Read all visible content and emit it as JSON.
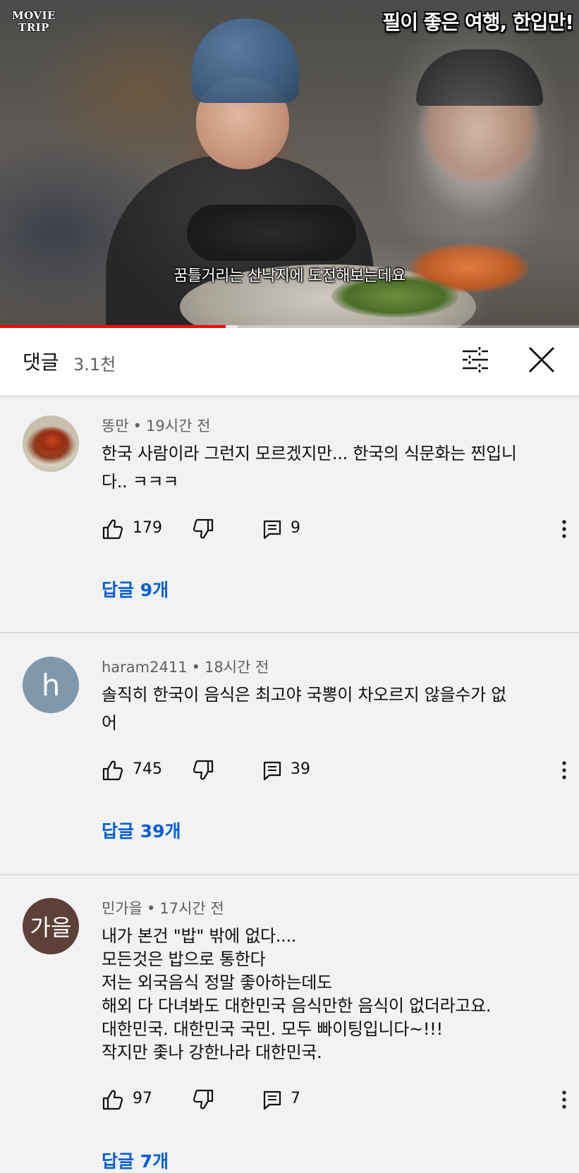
{
  "video": {
    "logo_line1": "MOVIE",
    "logo_line2": "TRIP",
    "title_overlay": "필이 좋은 여행, 한입만!",
    "subtitle": "꿈틀거리는 산낙지에 도전해보는데요",
    "progress_fraction": 0.39,
    "buffer_fraction": 0.02
  },
  "comments_header": {
    "title": "댓글",
    "count": "3.1천",
    "filter_icon": "sliders-icon",
    "close_icon": "close-icon"
  },
  "comments": [
    {
      "author": "똥만",
      "time": "19시간 전",
      "text_lines": [
        "한국 사람이라 그런지 모르겠지만... 한국의 식문화는 찐입니",
        "다.. ㅋㅋㅋ"
      ],
      "likes": "179",
      "replies_count": "9",
      "replies_label": "답글 9개",
      "avatar": "food-photo"
    },
    {
      "author": "haram2411",
      "time": "18시간 전",
      "text_lines": [
        "솔직히 한국이 음식은 최고야 국뽕이 차오르지 않을수가 없",
        "어"
      ],
      "likes": "745",
      "replies_count": "39",
      "replies_label": "답글 39개",
      "avatar_letter": "h"
    },
    {
      "author": "민가을",
      "time": "17시간 전",
      "text_lines": [
        "내가 본건 \"밥\" 밖에 없다....",
        "모든것은 밥으로 통한다",
        "저는 외국음식 정말 좋아하는데도",
        "해외 다 다녀봐도 대한민국 음식만한 음식이 없더라고요.",
        "대한민국. 대한민국 국민. 모두 빠이팅입니다~!!!",
        "작지만 좇나 강한나라 대한민국."
      ],
      "likes": "97",
      "replies_count": "7",
      "replies_label": "답글 7개",
      "avatar_text": "가을"
    }
  ],
  "icons": {
    "like": "thumbs-up-icon",
    "dislike": "thumbs-down-icon",
    "reply": "comment-icon",
    "more": "more-vertical-icon"
  },
  "colors": {
    "progress": "#ff0000",
    "link": "#065fd4",
    "avatar_h": "#7f98ac",
    "avatar_ga": "#5d4037"
  }
}
